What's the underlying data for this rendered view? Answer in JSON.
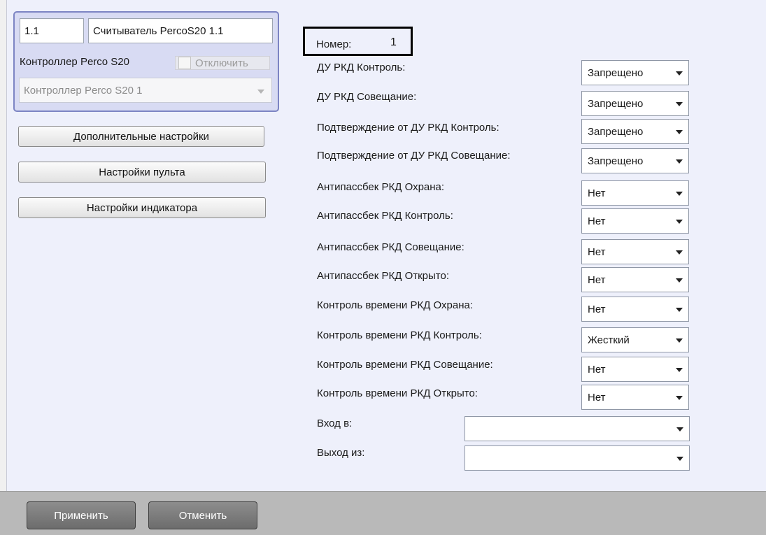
{
  "reader": {
    "id_value": "1.1",
    "name_value": "Считыватель PercoS20 1.1",
    "controller_label": "Контроллер Perco S20",
    "disable_label": "Отключить",
    "controller_select_value": "Контроллер Perco S20 1"
  },
  "side_buttons": {
    "extra_settings": "Дополнительные настройки",
    "console_settings": "Настройки пульта",
    "indicator_settings": "Настройки индикатора"
  },
  "number": {
    "label": "Номер:",
    "value": "1"
  },
  "settings": [
    {
      "label": "ДУ РКД Контроль:",
      "value": "Запрещено"
    },
    {
      "label": "ДУ РКД Совещание:",
      "value": "Запрещено"
    },
    {
      "label": "Подтверждение от ДУ РКД Контроль:",
      "value": "Запрещено"
    },
    {
      "label": "Подтверждение от ДУ РКД Совещание:",
      "value": "Запрещено"
    },
    {
      "label": "Антипассбек РКД Охрана:",
      "value": "Нет"
    },
    {
      "label": "Антипассбек РКД Контроль:",
      "value": "Нет"
    },
    {
      "label": "Антипассбек РКД Совещание:",
      "value": "Нет"
    },
    {
      "label": "Антипассбек РКД Открыто:",
      "value": "Нет"
    },
    {
      "label": "Контроль времени РКД Охрана:",
      "value": "Нет"
    },
    {
      "label": "Контроль времени РКД Контроль:",
      "value": "Жесткий"
    },
    {
      "label": "Контроль времени РКД Совещание:",
      "value": "Нет"
    },
    {
      "label": "Контроль времени РКД Открыто:",
      "value": "Нет"
    }
  ],
  "entry": {
    "label": "Вход в:",
    "value": ""
  },
  "exit": {
    "label": "Выход из:",
    "value": ""
  },
  "footer": {
    "apply_label": "Применить",
    "cancel_label": "Отменить"
  }
}
